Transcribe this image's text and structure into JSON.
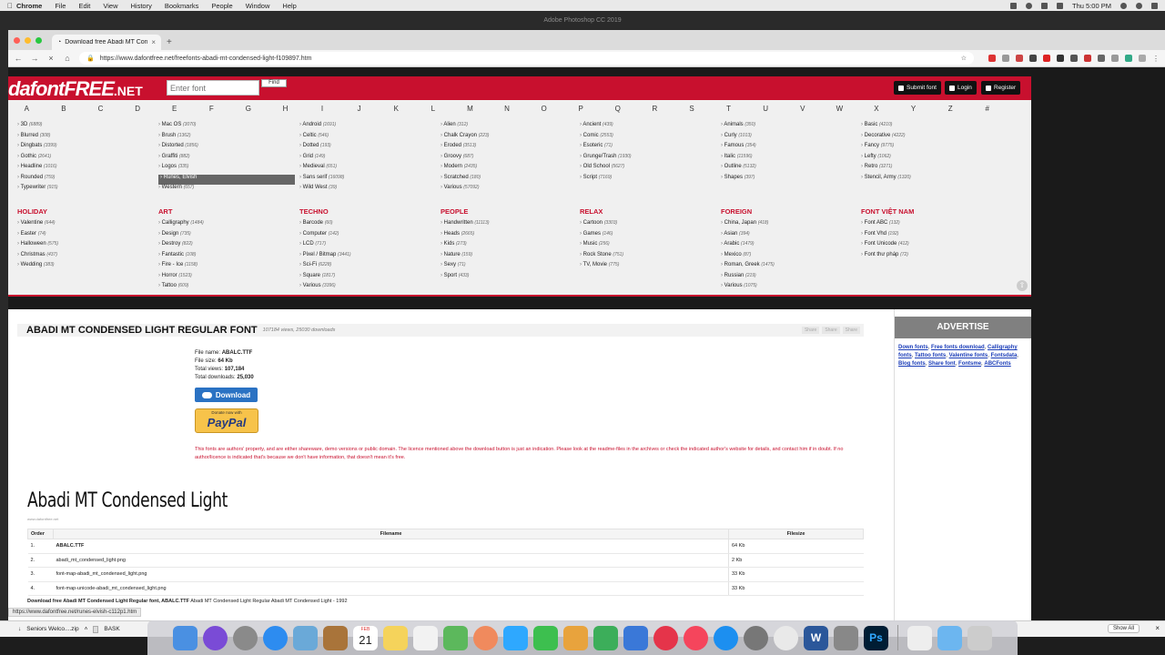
{
  "menubar": {
    "app": "Chrome",
    "items": [
      "File",
      "Edit",
      "View",
      "History",
      "Bookmarks",
      "People",
      "Window",
      "Help"
    ],
    "clock": "Thu 5:00 PM"
  },
  "photoshop_title": "Adobe Photoshop CC 2019",
  "browser": {
    "tab_title": "Download free Abadi MT Conde",
    "url": "https://www.dafontfree.net/freefonts-abadi-mt-condensed-light-f109897.htm"
  },
  "site": {
    "logo_main": "dafontFREE",
    "logo_suffix": ".NET",
    "search_placeholder": "Enter font",
    "find_label": "Find",
    "submit_label": "Submit font",
    "login_label": "Login",
    "register_label": "Register"
  },
  "alphabet": [
    "A",
    "B",
    "C",
    "D",
    "E",
    "F",
    "G",
    "H",
    "I",
    "J",
    "K",
    "L",
    "M",
    "N",
    "O",
    "P",
    "Q",
    "R",
    "S",
    "T",
    "U",
    "V",
    "W",
    "X",
    "Y",
    "Z",
    "#"
  ],
  "categories": {
    "col1": [
      [
        "3D",
        "6889"
      ],
      [
        "Blurred",
        "308"
      ],
      [
        "Dingbats",
        "3399"
      ],
      [
        "Gothic",
        "2641"
      ],
      [
        "Headline",
        "1016"
      ],
      [
        "Rounded",
        "759"
      ],
      [
        "Typewriter",
        "915"
      ]
    ],
    "col2": [
      [
        "Mac OS",
        "3070"
      ],
      [
        "Brush",
        "1362"
      ],
      [
        "Distorted",
        "1856"
      ],
      [
        "Graffiti",
        "882"
      ],
      [
        "Logos",
        "335"
      ],
      [
        "Runes, Elvish",
        "1118"
      ],
      [
        "Western",
        "657"
      ]
    ],
    "col3": [
      [
        "Android",
        "1691"
      ],
      [
        "Celtic",
        "546"
      ],
      [
        "Dotted",
        "193"
      ],
      [
        "Grid",
        "149"
      ],
      [
        "Medieval",
        "651"
      ],
      [
        "Sans serif",
        "16098"
      ],
      [
        "Wild West",
        "39"
      ]
    ],
    "col4": [
      [
        "Alien",
        "312"
      ],
      [
        "Chalk Crayon",
        "223"
      ],
      [
        "Eroded",
        "3513"
      ],
      [
        "Groovy",
        "687"
      ],
      [
        "Modern",
        "2435"
      ],
      [
        "Scratched",
        "180"
      ],
      [
        "Various",
        "57092"
      ]
    ],
    "col5": [
      [
        "Ancient",
        "439"
      ],
      [
        "Comic",
        "2553"
      ],
      [
        "Esoteric",
        "71"
      ],
      [
        "Grunge/Trash",
        "1930"
      ],
      [
        "Old School",
        "5627"
      ],
      [
        "Script",
        "7169"
      ]
    ],
    "col6": [
      [
        "Animals",
        "350"
      ],
      [
        "Curly",
        "1013"
      ],
      [
        "Famous",
        "354"
      ],
      [
        "Italic",
        "11596"
      ],
      [
        "Outline",
        "5132"
      ],
      [
        "Shapes",
        "397"
      ]
    ],
    "col7": [
      [
        "Basic",
        "4210"
      ],
      [
        "Decorative",
        "4222"
      ],
      [
        "Fancy",
        "9775"
      ],
      [
        "Lefty",
        "1062"
      ],
      [
        "Retro",
        "3271"
      ],
      [
        "Stencil, Army",
        "1320"
      ]
    ]
  },
  "groups": [
    {
      "head": "HOLIDAY",
      "items": [
        [
          "Valentine",
          "644"
        ],
        [
          "Easter",
          "74"
        ],
        [
          "Halloween",
          "575"
        ],
        [
          "Christmas",
          "437"
        ],
        [
          "Wedding",
          "383"
        ]
      ]
    },
    {
      "head": "ART",
      "items": [
        [
          "Calligraphy",
          "1484"
        ],
        [
          "Design",
          "735"
        ],
        [
          "Destroy",
          "822"
        ],
        [
          "Fantastic",
          "108"
        ],
        [
          "Fire - Ice",
          "1158"
        ],
        [
          "Horror",
          "1523"
        ],
        [
          "Tattoo",
          "609"
        ]
      ]
    },
    {
      "head": "TECHNO",
      "items": [
        [
          "Barcode",
          "60"
        ],
        [
          "Computer",
          "142"
        ],
        [
          "LCD",
          "717"
        ],
        [
          "Pixel / Bitmap",
          "3441"
        ],
        [
          "Sci-Fi",
          "6228"
        ],
        [
          "Square",
          "1817"
        ],
        [
          "Various",
          "3396"
        ]
      ]
    },
    {
      "head": "PEOPLE",
      "items": [
        [
          "Handwritten",
          "11113"
        ],
        [
          "Heads",
          "2665"
        ],
        [
          "Kids",
          "273"
        ],
        [
          "Nature",
          "159"
        ],
        [
          "Sexy",
          "71"
        ],
        [
          "Sport",
          "433"
        ]
      ]
    },
    {
      "head": "RELAX",
      "items": [
        [
          "Cartoon",
          "3303"
        ],
        [
          "Games",
          "146"
        ],
        [
          "Music",
          "256"
        ],
        [
          "Rock Stone",
          "751"
        ],
        [
          "TV, Movie",
          "775"
        ]
      ]
    },
    {
      "head": "FOREIGN",
      "items": [
        [
          "China, Japan",
          "418"
        ],
        [
          "Asian",
          "394"
        ],
        [
          "Arabic",
          "1479"
        ],
        [
          "Mexico",
          "87"
        ],
        [
          "Roman, Greek",
          "1475"
        ],
        [
          "Russian",
          "219"
        ],
        [
          "Various",
          "1075"
        ]
      ]
    },
    {
      "head": "FONT VIỆT NAM",
      "items": [
        [
          "Font ABC",
          "132"
        ],
        [
          "Font Vhd",
          "192"
        ],
        [
          "Font Unicode",
          "412"
        ],
        [
          "Font thư pháp",
          "72"
        ]
      ]
    }
  ],
  "font": {
    "title": "ABADI MT CONDENSED LIGHT REGULAR FONT",
    "stats": "107184 views, 25030 downloads",
    "share": [
      "Share",
      "Share",
      "Share"
    ],
    "file_name_label": "File name:",
    "file_name": "ABALC.TTF",
    "file_size_label": "File size:",
    "file_size": "64 Kb",
    "views_label": "Total views:",
    "views": "107,184",
    "downloads_label": "Total downloads:",
    "downloads": "25,030",
    "download_label": "Download",
    "paypal_small": "Donate now with",
    "paypal_big": "PayPal",
    "disclaimer": "This fonts are authors' property, and are either shareware, demo versions or public domain. The licence mentioned above the download button is just an indication. Please look at the readme-files in the archives or check the indicated author's website for details, and contact him if in doubt. If no author/licence is indicated that's because we don't have information, that doesn't mean it's free.",
    "preview_text": "Abadi MT Condensed Light",
    "preview_sub": "www.dafontfree.net"
  },
  "files_table": {
    "headers": [
      "Order",
      "Filename",
      "Filesize"
    ],
    "rows": [
      [
        "1.",
        "ABALC.TTF",
        "64 Kb"
      ],
      [
        "2.",
        "abadi_mt_condensed_light.png",
        "2 Kb"
      ],
      [
        "3.",
        "font-map-abadi_mt_condensed_light.png",
        "33 Kb"
      ],
      [
        "4.",
        "font-map-unicode-abadi_mt_condensed_light.png",
        "33 Kb"
      ]
    ]
  },
  "caption": {
    "bold": "Download free Abadi MT Condensed Light Regular font, ABALC.TTF",
    "rest": " Abadi MT Condensed Light Regular Abadi MT Condensed Light - 1992"
  },
  "sidebar": {
    "heading": "ADVERTISE",
    "links": [
      "Down fonts",
      "Free fonts download",
      "Calligraphy fonts",
      "Tattoo fonts",
      "Valentine fonts",
      "Fontsdata",
      "Blog fonts",
      "Share font",
      "Fontsme",
      "ABCFonts"
    ]
  },
  "status_url": "https://www.dafontfree.net/runes-elvish-c112p1.htm",
  "shelf": {
    "file": "Seniors Welco....zip",
    "file2": "BASK",
    "show_all": "Show All"
  },
  "colors": {
    "brand_red": "#c8102e",
    "link_blue": "#1a3cb8",
    "paypal_yellow": "#f7c34a",
    "download_blue": "#2a72c3"
  },
  "dock_icons": [
    "finder-icon",
    "siri-icon",
    "launchpad-icon",
    "safari-icon",
    "preview-icon",
    "contacts-icon",
    "calendar-icon",
    "notes-icon",
    "reminders-icon",
    "maps-icon",
    "photos-icon",
    "messages-icon",
    "facetime-icon",
    "keynote-icon",
    "numbers-icon",
    "keynote2-icon",
    "news-icon",
    "music-icon",
    "app-store-icon",
    "system-prefs-icon",
    "chrome-icon",
    "word-icon",
    "font-book-icon",
    "photoshop-icon",
    "document-icon",
    "folder-icon",
    "trash-icon"
  ],
  "calendar_day": "21",
  "calendar_month": "FEB"
}
